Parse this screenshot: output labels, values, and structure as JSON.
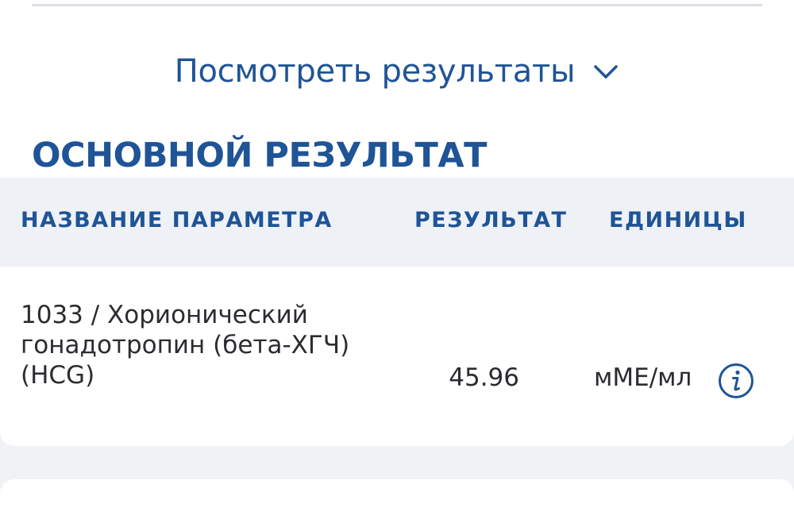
{
  "toggle": {
    "label": "Посмотреть результаты",
    "icon": "chevron-down-icon"
  },
  "section": {
    "title": "ОСНОВНОЙ РЕЗУЛЬТАТ"
  },
  "table": {
    "columns": [
      "НАЗВАНИЕ ПАРАМЕТРА",
      "РЕЗУЛЬТАТ",
      "ЕДИНИЦЫ"
    ],
    "rows": [
      {
        "name": "1033 / Хорионический гонадотропин (бета-ХГЧ) (HCG)",
        "result": "45.96",
        "units": "мМЕ/мл",
        "info_icon": "info-icon"
      }
    ]
  },
  "colors": {
    "accent": "#1f5496",
    "background": "#f1f2f6",
    "header_bg": "#eef1f6",
    "text": "#2a2c30"
  }
}
